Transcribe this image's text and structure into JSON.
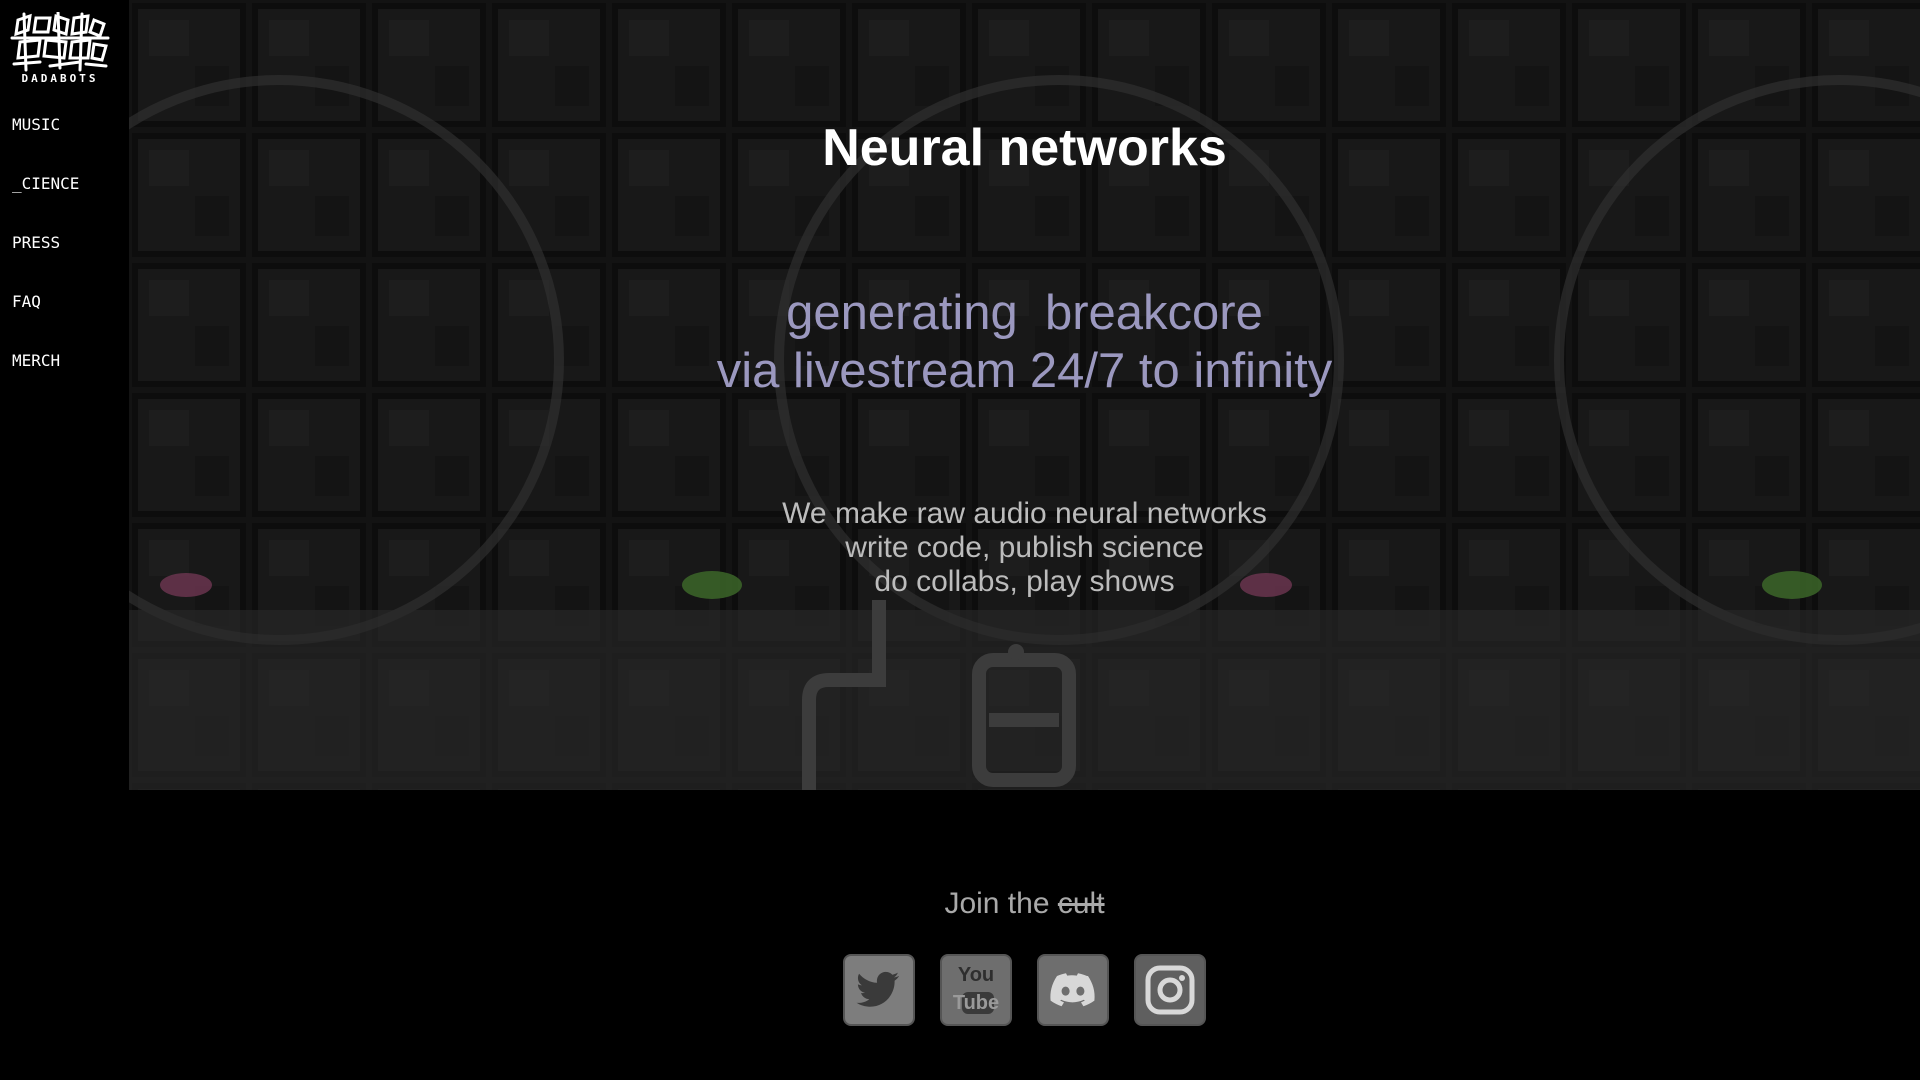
{
  "brand": {
    "name": "DADABOTS",
    "logo_icon": "dadabots-logo"
  },
  "sidebar": {
    "items": [
      {
        "label": "MUSIC"
      },
      {
        "label": "_CIENCE"
      },
      {
        "label": "PRESS"
      },
      {
        "label": "FAQ"
      },
      {
        "label": "MERCH"
      }
    ]
  },
  "hero": {
    "title": "Neural networks",
    "tagline_line1": "generating  breakcore",
    "tagline_line2": "via livestream 24/7 to infinity",
    "desc_line1": "We make raw audio neural networks",
    "desc_line2": "write code, publish science",
    "desc_line3": "do collabs, play shows",
    "background_icon": "robot-lab-artwork"
  },
  "footer": {
    "join_text": "Join the ",
    "join_strike": "cult",
    "socials": [
      {
        "icon": "twitter-icon"
      },
      {
        "icon": "youtube-icon",
        "label_top": "You",
        "label_bottom": "Tube"
      },
      {
        "icon": "discord-icon"
      },
      {
        "icon": "instagram-icon"
      }
    ]
  },
  "colors": {
    "background": "#000000",
    "title": "#ffffff",
    "tagline": "#9b98bf",
    "desc": "#bcbcbc",
    "join": "#a9a9a9",
    "social_button": "#7a7a7a"
  }
}
